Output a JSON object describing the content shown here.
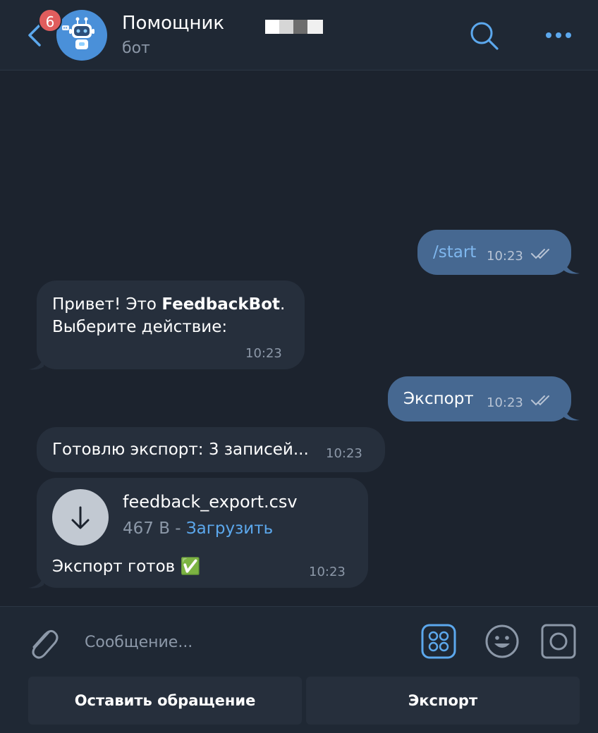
{
  "header": {
    "unread_count": "6",
    "title": "Помощник",
    "subtitle": "бот",
    "avatar_icon": "robot-icon",
    "accent": "#5ca8ed"
  },
  "messages": [
    {
      "direction": "out",
      "text": "/start",
      "time": "10:23",
      "status": "read"
    },
    {
      "direction": "in",
      "line1_prefix": "Привет! Это ",
      "line1_bold": "FeedbackBot",
      "line1_suffix": ".",
      "line2": "Выберите действие:",
      "time": "10:23"
    },
    {
      "direction": "out",
      "text": "Экспорт",
      "time": "10:23",
      "status": "read"
    },
    {
      "direction": "in",
      "text": "Готовлю экспорт: 3 записей...",
      "time": "10:23"
    },
    {
      "direction": "in",
      "file_name": "feedback_export.csv",
      "file_size": "467 B",
      "separator": " - ",
      "download_label": "Загрузить",
      "caption": "Экспорт готов ✅",
      "time": "10:23"
    }
  ],
  "composer": {
    "placeholder": "Сообщение..."
  },
  "keyboard": {
    "buttons": [
      "Оставить обращение",
      "Экспорт"
    ]
  },
  "colors": {
    "background": "#1c232e",
    "outgoing_bubble": "#466891",
    "incoming_bubble": "#262f3c",
    "badge": "#e05d5d"
  }
}
